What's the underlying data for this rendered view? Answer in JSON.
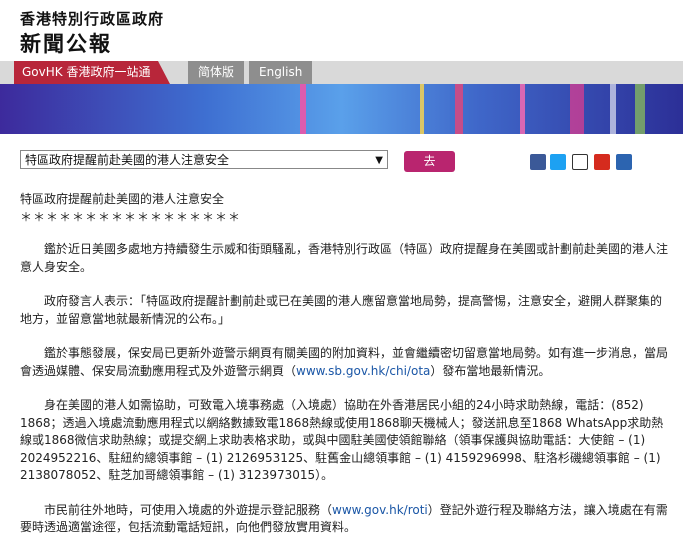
{
  "header": {
    "org": "香港特別行政區政府",
    "title": "新聞公報"
  },
  "nav": {
    "govhk": "GovHK 香港政府一站通",
    "simplified": "简体版",
    "english": "English"
  },
  "toolbar": {
    "select_value": "特區政府提醒前赴美國的港人注意安全",
    "go_label": "去"
  },
  "share_icons": [
    "facebook-icon",
    "twitter-icon",
    "mail-icon",
    "weibo-icon",
    "print-icon"
  ],
  "article": {
    "headline": "特區政府提醒前赴美國的港人注意安全",
    "stars": "＊＊＊＊＊＊＊＊＊＊＊＊＊＊＊＊＊",
    "p1": "鑑於近日美國多處地方持續發生示威和街頭騷亂，香港特別行政區（特區）政府提醒身在美國或計劃前赴美國的港人注意人身安全。",
    "p2": "政府發言人表示：「特區政府提醒計劃前赴或已在美國的港人應留意當地局勢，提高警惕，注意安全，避開人群聚集的地方，並留意當地就最新情況的公布。」",
    "p3a": "鑑於事態發展，保安局已更新外遊警示網頁有關美國的附加資料，並會繼續密切留意當地局勢。如有進一步消息，當局會透過媒體、保安局流動應用程式及外遊警示網頁（",
    "p3_link": "www.sb.gov.hk/chi/ota",
    "p3b": "）發布當地最新情況。",
    "p4": "身在美國的港人如需協助，可致電入境事務處（入境處）協助在外香港居民小組的24小時求助熱線，電話：(852) 1868；透過入境處流動應用程式以網絡數據致電1868熱線或使用1868聊天機械人；發送訊息至1868 WhatsApp求助熱線或1868微信求助熱線；或提交網上求助表格求助，或與中國駐美國使領館聯絡（領事保護與協助電話：大使館 – (1) 2024952216、駐紐約總領事館 – (1) 2126953125、駐舊金山總領事館 – (1) 4159296998、駐洛杉磯總領事館 – (1) 2138078052、駐芝加哥總領事館 – (1) 3123973015）。",
    "p5a": "市民前往外地時，可使用入境處的外遊提示登記服務（",
    "p5_link": "www.gov.hk/roti",
    "p5b": "）登記外遊行程及聯絡方法，讓入境處在有需要時透過適當途徑，包括流動電話短訊，向他們發放實用資料。"
  }
}
